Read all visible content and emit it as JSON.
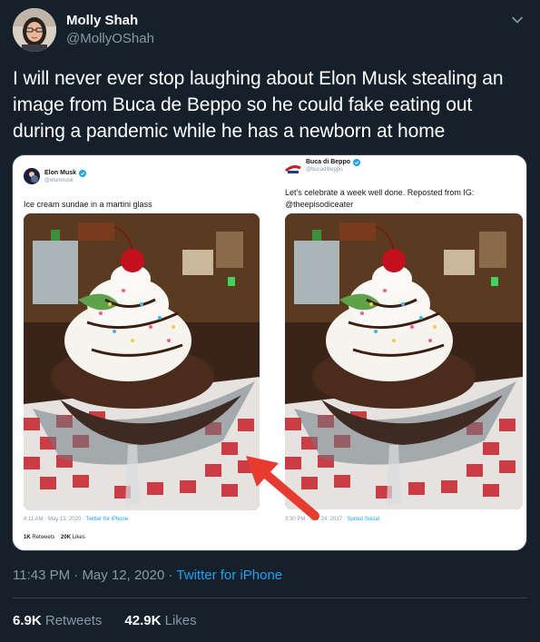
{
  "tweet": {
    "author_name": "Molly Shah",
    "author_handle": "@MollyOShah",
    "text": "I will never ever stop laughing about Elon Musk stealing an image from Buca de Beppo so he could fake eating out during a pandemic while he has a newborn at home",
    "time": "11:43 PM",
    "date": "May 12, 2020",
    "source": "Twitter for iPhone",
    "retweets_count": "6.9K",
    "retweets_label": "Retweets",
    "likes_count": "42.9K",
    "likes_label": "Likes"
  },
  "embedded_left": {
    "name": "Elon Musk",
    "handle": "@elonmusk",
    "text": "Ice cream sundae in a martini glass",
    "time": "4:11 AM · May 13, 2020 ·",
    "source": "Twitter for iPhone",
    "retweets_count": "1K",
    "retweets_label": "Retweets",
    "likes_count": "20K",
    "likes_label": "Likes"
  },
  "embedded_right": {
    "name": "Buca di Beppo",
    "handle": "@bucadibeppo",
    "text_line1": "Let's celebrate a week well done. Reposted from IG:",
    "text_line2": "@theepisodiceater",
    "time": "3:30 PM · Mar 24, 2017 ·",
    "source": "Sprout Social"
  },
  "icons": {
    "more": "chevron-down-icon",
    "verified": "verified-badge-icon",
    "arrow": "red-arrow-annotation"
  },
  "colors": {
    "background": "#15202b",
    "link": "#1da1f2",
    "muted": "#8899a6",
    "arrow": "#e63b2e"
  }
}
